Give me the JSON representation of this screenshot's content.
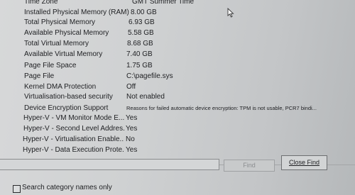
{
  "rows": [
    {
      "item": "Time Zone",
      "value": "GMT Summer Time"
    },
    {
      "item": "Installed Physical Memory (RAM)",
      "value": "8.00 GB"
    },
    {
      "item": "Total Physical Memory",
      "value": "6.93 GB"
    },
    {
      "item": "Available Physical Memory",
      "value": "5.58 GB"
    },
    {
      "item": "Total Virtual Memory",
      "value": "8.68 GB"
    },
    {
      "item": "Available Virtual Memory",
      "value": "7.40 GB"
    },
    {
      "item": "Page File Space",
      "value": "1.75 GB"
    },
    {
      "item": "Page File",
      "value": "C:\\pagefile.sys"
    },
    {
      "item": "Kernel DMA Protection",
      "value": "Off"
    },
    {
      "item": "Virtualisation-based security",
      "value": "Not enabled"
    },
    {
      "item": "Device Encryption Support",
      "value": "Reasons for failed automatic device encryption: TPM is not usable, PCR7 bindi..."
    },
    {
      "item": "Hyper-V - VM Monitor Mode E...",
      "value": "Yes"
    },
    {
      "item": "Hyper-V - Second Level Addres...",
      "value": "Yes"
    },
    {
      "item": "Hyper-V - Virtualisation Enable...",
      "value": "No"
    },
    {
      "item": "Hyper-V - Data Execution Prote...",
      "value": "Yes"
    }
  ],
  "find": {
    "input_value": "",
    "find_label": "Find",
    "close_label": "Close Find",
    "search_category_label": "Search category names only"
  }
}
